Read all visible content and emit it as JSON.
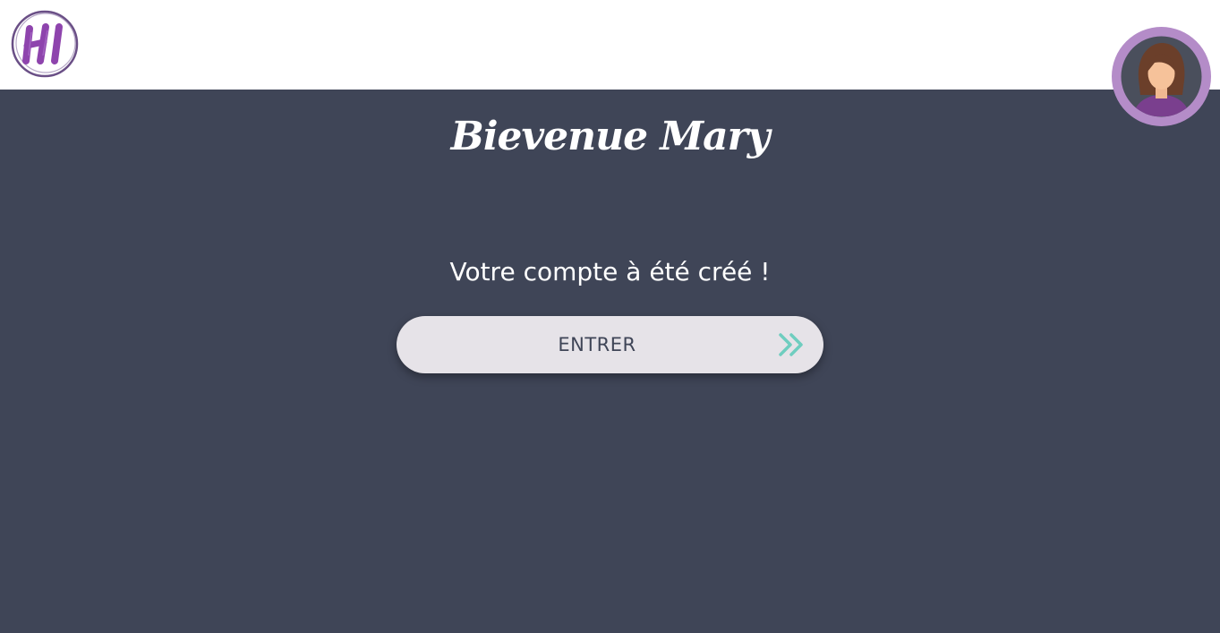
{
  "header": {
    "logo_icon": "hi-logo-icon",
    "avatar_icon": "user-avatar-icon"
  },
  "main": {
    "title": "Bievenue Mary",
    "message": "Votre compte à été créé !",
    "enter_button_label": "ENTRER",
    "enter_button_icon": "double-chevron-right-icon"
  },
  "colors": {
    "background": "#3f4557",
    "topbar": "#ffffff",
    "button_bg": "#e6e3e8",
    "button_text": "#3f4557",
    "accent_teal": "#6fcdbf",
    "brand_purple": "#8e44ad",
    "avatar_ring": "#b48cc8"
  }
}
